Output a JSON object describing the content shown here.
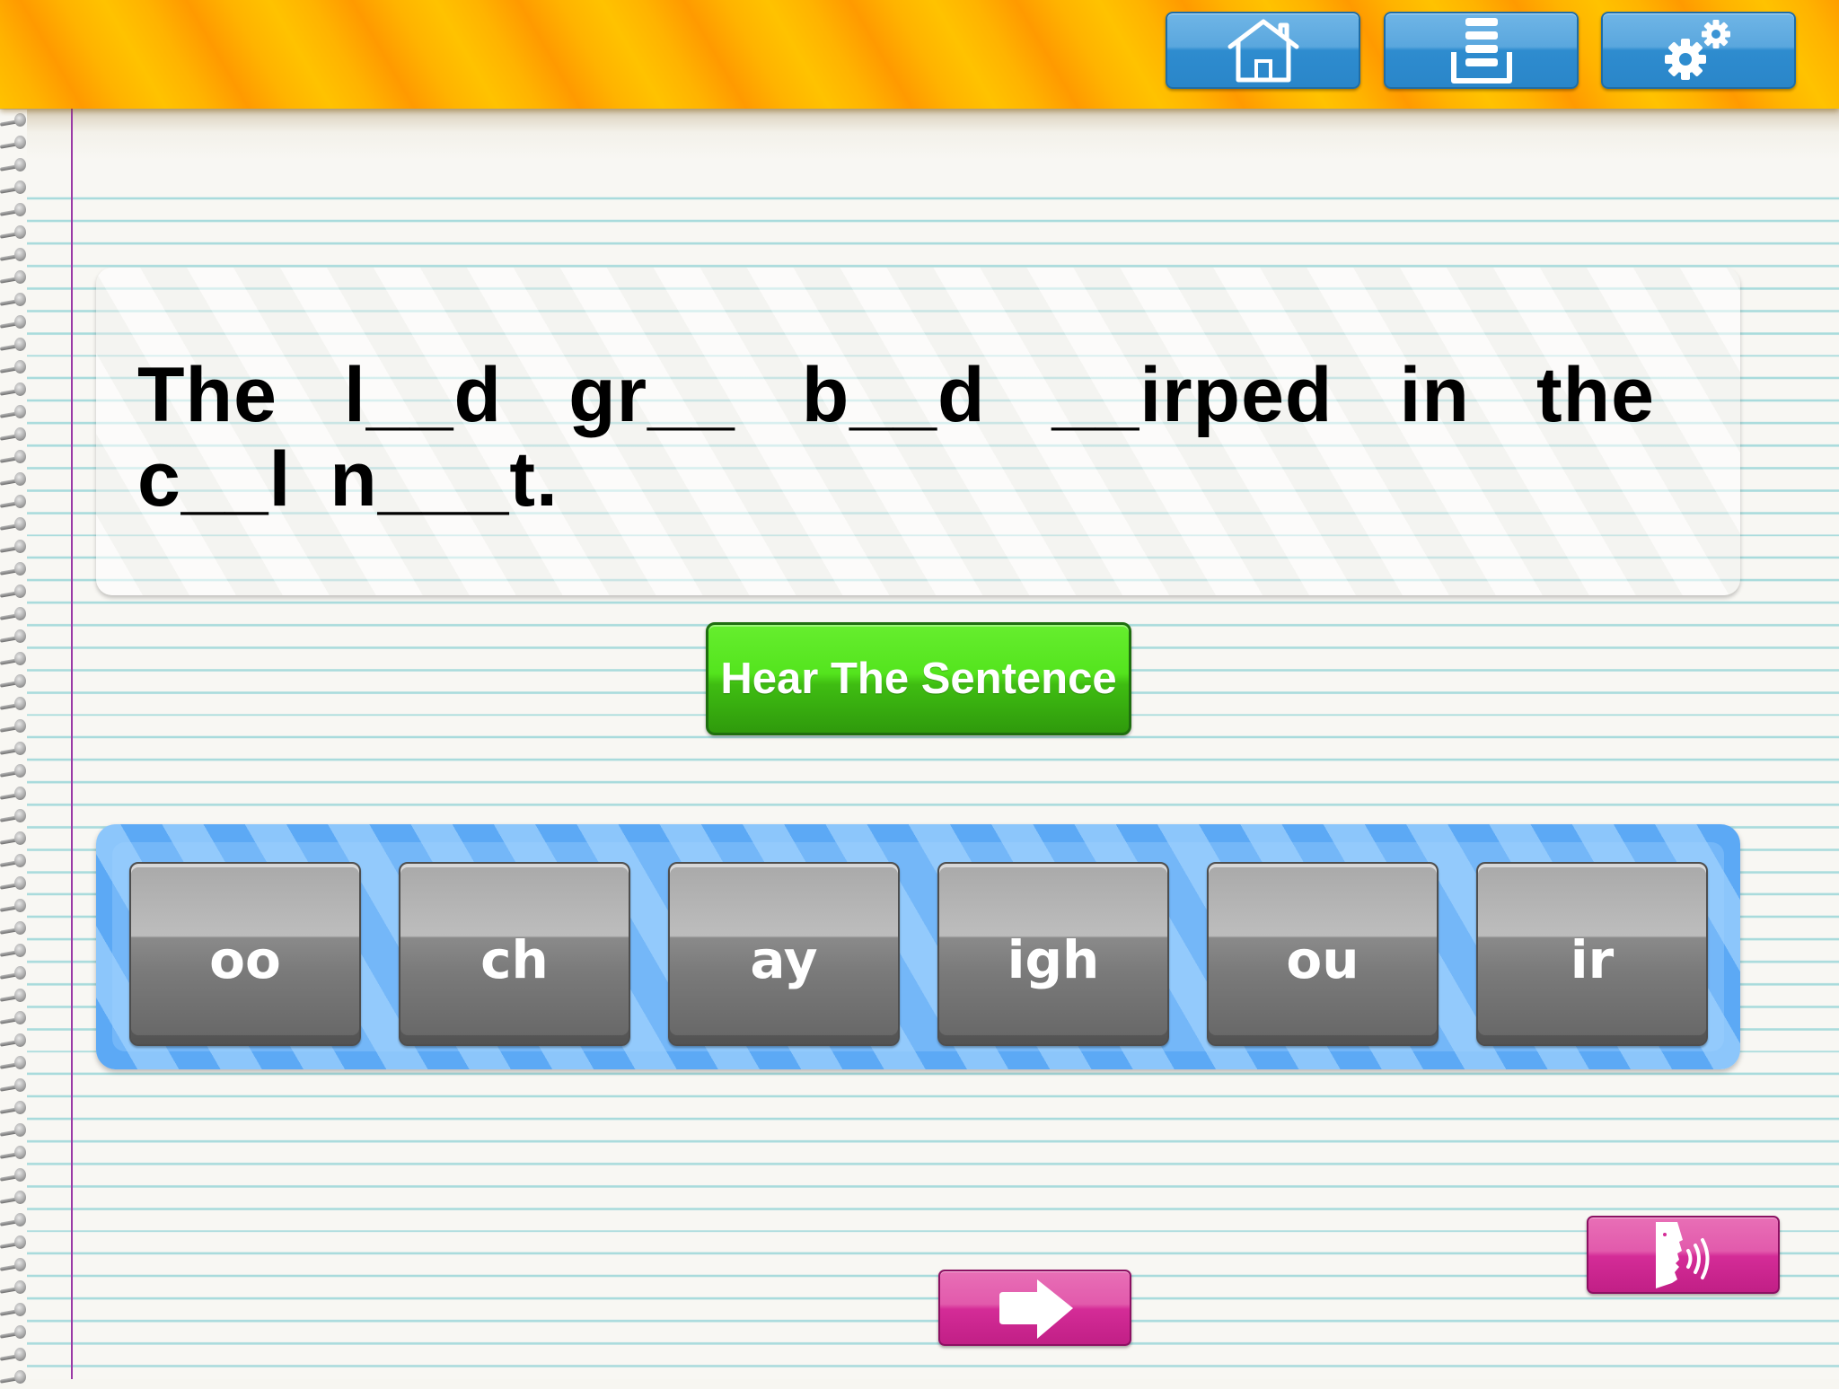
{
  "header": {
    "buttons": [
      {
        "id": "home",
        "icon": "home-icon"
      },
      {
        "id": "list",
        "icon": "list-icon"
      },
      {
        "id": "settings",
        "icon": "gears-icon"
      }
    ],
    "background_colors": [
      "#ffc200",
      "#ff9a00"
    ]
  },
  "sentence": {
    "words": [
      "The",
      "l__d",
      "gr__",
      "b__d",
      "__irped",
      "in",
      "the",
      "c__l",
      "n___t."
    ]
  },
  "hear_button": {
    "label": "Hear The Sentence",
    "color": "#4cd41a"
  },
  "tiles": [
    {
      "label": "oo"
    },
    {
      "label": "ch"
    },
    {
      "label": "ay"
    },
    {
      "label": "igh"
    },
    {
      "label": "ou"
    },
    {
      "label": "ir"
    }
  ],
  "bottom_buttons": {
    "next": {
      "icon": "right-arrow-icon"
    },
    "speak": {
      "icon": "speaking-head-icon"
    },
    "color": "#d42c97"
  }
}
